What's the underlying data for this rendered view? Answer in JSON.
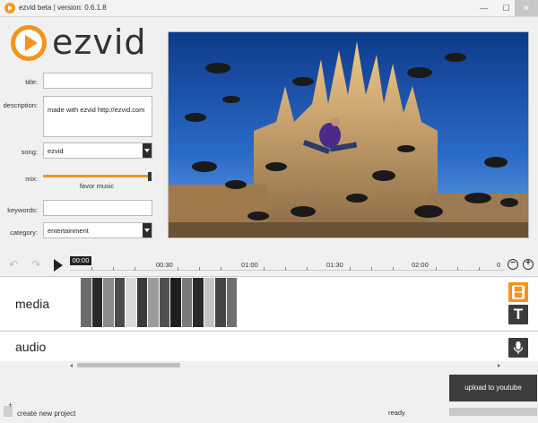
{
  "window": {
    "title": "ezvid beta | version: 0.6.1.8",
    "min": "—",
    "max": "☐",
    "close": "✕"
  },
  "logo": {
    "text": "ezvid"
  },
  "form": {
    "title_label": "title:",
    "title_value": "",
    "description_label": "description:",
    "description_value": "made with ezvid http://ezvid.com",
    "song_label": "song:",
    "song_value": "ezvid",
    "mix_label": "mix:",
    "mix_caption": "favor music",
    "mix_level": 0.98,
    "keywords_label": "keywords:",
    "keywords_value": "",
    "category_label": "category:",
    "category_value": "entertainment"
  },
  "timeline": {
    "playhead_time": "00:00",
    "ticks": [
      "00:30",
      "01:00",
      "01:30",
      "02:00",
      "0"
    ],
    "undo_icon": "undo-arrow-icon",
    "redo_icon": "redo-arrow-icon",
    "zoom_out": "−",
    "zoom_in": "+"
  },
  "tracks": {
    "media_label": "media",
    "audio_label": "audio",
    "text_button": "T"
  },
  "clips": [
    "#6b6b6b",
    "#2a2a2a",
    "#8a8a8a",
    "#4a4a4a",
    "#d9d9d9",
    "#3a3a3a",
    "#9b9b9b",
    "#505050",
    "#1f1f1f",
    "#7a7a7a",
    "#2b2b2b",
    "#c4c4c4",
    "#454545",
    "#6f6f6f"
  ],
  "bottom": {
    "upload_label": "upload to youtube",
    "status": "ready",
    "new_project": "create new project"
  },
  "colors": {
    "accent": "#f3941c",
    "dark": "#3d3d3d"
  }
}
